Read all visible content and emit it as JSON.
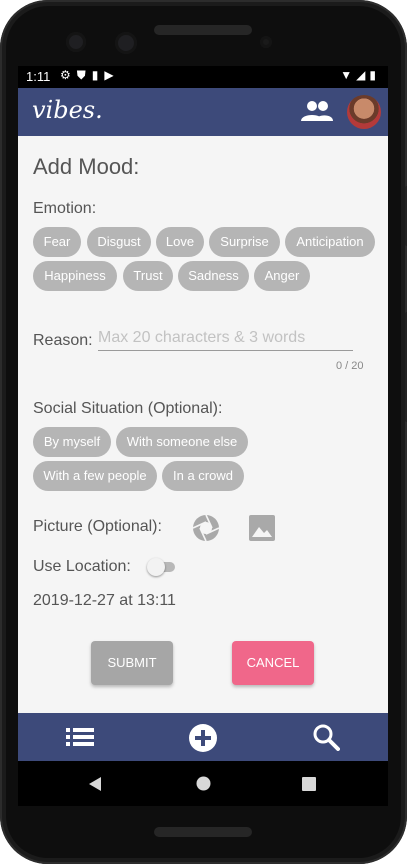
{
  "status_bar": {
    "time": "1:11"
  },
  "app_bar": {
    "logo": "vibes.",
    "icons": [
      "people-icon",
      "avatar"
    ]
  },
  "form": {
    "title": "Add Mood:",
    "emotion_label": "Emotion:",
    "emotions": [
      "Fear",
      "Disgust",
      "Love",
      "Surprise",
      "Anticipation",
      "Happiness",
      "Trust",
      "Sadness",
      "Anger"
    ],
    "reason_label": "Reason:",
    "reason_placeholder": "Max 20 characters & 3 words",
    "reason_counter": "0 / 20",
    "social_label": "Social Situation (Optional):",
    "social_options": [
      "By myself",
      "With someone else",
      "With a few people",
      "In a crowd"
    ],
    "picture_label": "Picture (Optional):",
    "location_label": "Use Location:",
    "location_enabled": false,
    "datetime": "2019-12-27 at 13:11",
    "submit_label": "SUBMIT",
    "cancel_label": "CANCEL"
  },
  "bottom_nav": {
    "items": [
      "list-icon",
      "add-circle-icon",
      "search-icon"
    ]
  },
  "system_nav": {
    "items": [
      "back-icon",
      "home-icon",
      "recents-icon"
    ]
  },
  "colors": {
    "primary": "#3d4a7a",
    "chip": "#b5b5b5",
    "submit": "#a6a6a6",
    "cancel": "#f0678a",
    "background": "#f5f5f5"
  }
}
